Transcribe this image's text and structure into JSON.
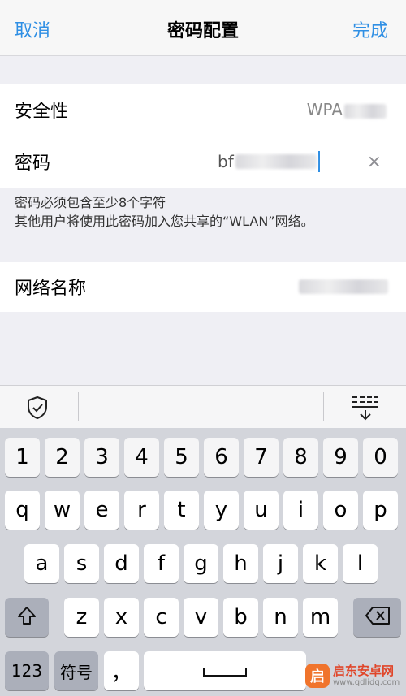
{
  "navbar": {
    "cancel": "取消",
    "title": "密码配置",
    "done": "完成"
  },
  "settings": {
    "security_label": "安全性",
    "security_value": "WPA",
    "password_label": "密码",
    "password_value": "bf",
    "clear_symbol": "×"
  },
  "footnote": {
    "line1": "密码必须包含至少8个字符",
    "line2": "其他用户将使用此密码加入您共享的“WLAN”网络。"
  },
  "network": {
    "name_label": "网络名称"
  },
  "keyboard": {
    "numbers": [
      "1",
      "2",
      "3",
      "4",
      "5",
      "6",
      "7",
      "8",
      "9",
      "0"
    ],
    "row1": [
      "q",
      "w",
      "e",
      "r",
      "t",
      "y",
      "u",
      "i",
      "o",
      "p"
    ],
    "row2": [
      "a",
      "s",
      "d",
      "f",
      "g",
      "h",
      "j",
      "k",
      "l"
    ],
    "row3": [
      "z",
      "x",
      "c",
      "v",
      "b",
      "n",
      "m"
    ],
    "key_123": "123",
    "key_symbols": "符号",
    "key_comma": "，"
  },
  "watermark": {
    "logo_glyph": "启",
    "name": "启东安卓网",
    "url": "www.qdlidq.com"
  },
  "colors": {
    "accent": "#2f8fe4",
    "keyboard_bg": "#d3d5db",
    "background": "#efeff4"
  },
  "icons": {
    "toolbar_left": "shield-check-icon",
    "toolbar_right": "keyboard-dismiss-icon",
    "shift": "shift-arrow-icon",
    "backspace": "backspace-icon",
    "space": "space-bar-icon"
  }
}
